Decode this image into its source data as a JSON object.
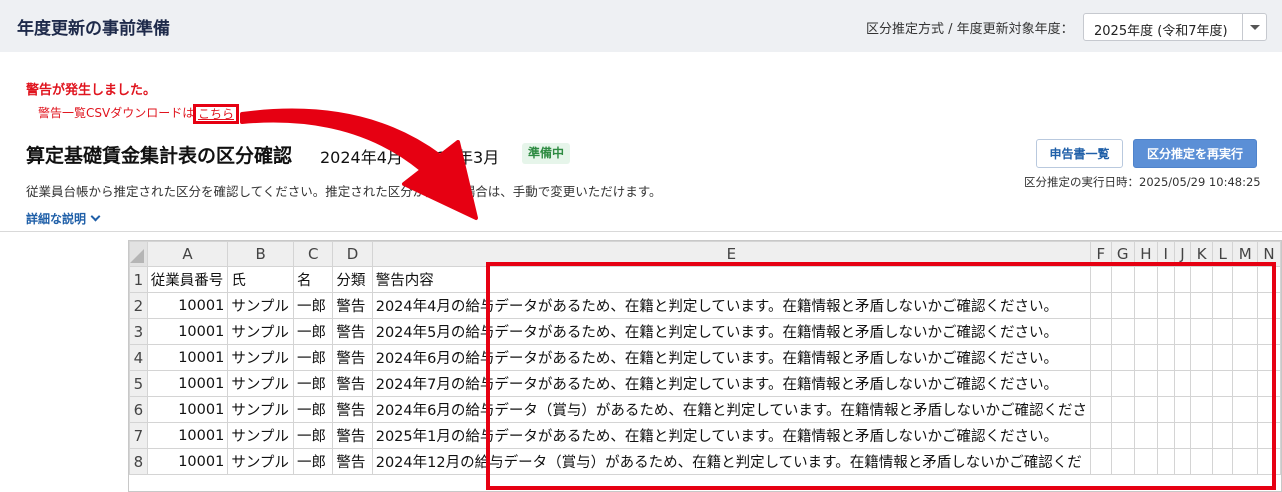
{
  "app": {
    "title": "年度更新の事前準備",
    "fiscal_year_label": "区分推定方式 / 年度更新対象年度：",
    "fiscal_year_selected": "2025年度 (令和7年度)"
  },
  "warning": {
    "title": "警告が発生しました。",
    "line_prefix": "警告一覧CSVダウンロードは",
    "link_label": "こちら"
  },
  "section": {
    "title": "算定基礎賃金集計表の区分確認",
    "period": "2024年4月~2025年3月",
    "status_badge": "準備中",
    "description": "従業員台帳から推定された区分を確認してください。推定された区分が異なる場合は、手動で変更いただけます。",
    "details_label": "詳細な説明",
    "buttons": {
      "report_list": "申告書一覧",
      "rerun": "区分推定を再実行"
    },
    "run_time": "区分推定の実行日時：2025/05/29 10:48:25"
  },
  "spreadsheet": {
    "columns": [
      "A",
      "B",
      "C",
      "D",
      "E",
      "F",
      "G",
      "H",
      "I",
      "J",
      "K",
      "L",
      "M",
      "N"
    ],
    "header_row": [
      "従業員番号",
      "氏",
      "名",
      "分類",
      "警告内容"
    ],
    "rows": [
      [
        "10001",
        "サンプル",
        "一郎",
        "警告",
        "2024年4月の給与データがあるため、在籍と判定しています。在籍情報と矛盾しないかご確認ください。"
      ],
      [
        "10001",
        "サンプル",
        "一郎",
        "警告",
        "2024年5月の給与データがあるため、在籍と判定しています。在籍情報と矛盾しないかご確認ください。"
      ],
      [
        "10001",
        "サンプル",
        "一郎",
        "警告",
        "2024年6月の給与データがあるため、在籍と判定しています。在籍情報と矛盾しないかご確認ください。"
      ],
      [
        "10001",
        "サンプル",
        "一郎",
        "警告",
        "2024年7月の給与データがあるため、在籍と判定しています。在籍情報と矛盾しないかご確認ください。"
      ],
      [
        "10001",
        "サンプル",
        "一郎",
        "警告",
        "2024年6月の給与データ（賞与）があるため、在籍と判定しています。在籍情報と矛盾しないかご確認くださ"
      ],
      [
        "10001",
        "サンプル",
        "一郎",
        "警告",
        "2025年1月の給与データがあるため、在籍と判定しています。在籍情報と矛盾しないかご確認ください。"
      ],
      [
        "10001",
        "サンプル",
        "一郎",
        "警告",
        "2024年12月の給与データ（賞与）があるため、在籍と判定しています。在籍情報と矛盾しないかご確認くだ"
      ]
    ]
  },
  "colors": {
    "highlight": "#e60012",
    "accent": "#5b8fd6",
    "warning_text": "#e0141e"
  }
}
